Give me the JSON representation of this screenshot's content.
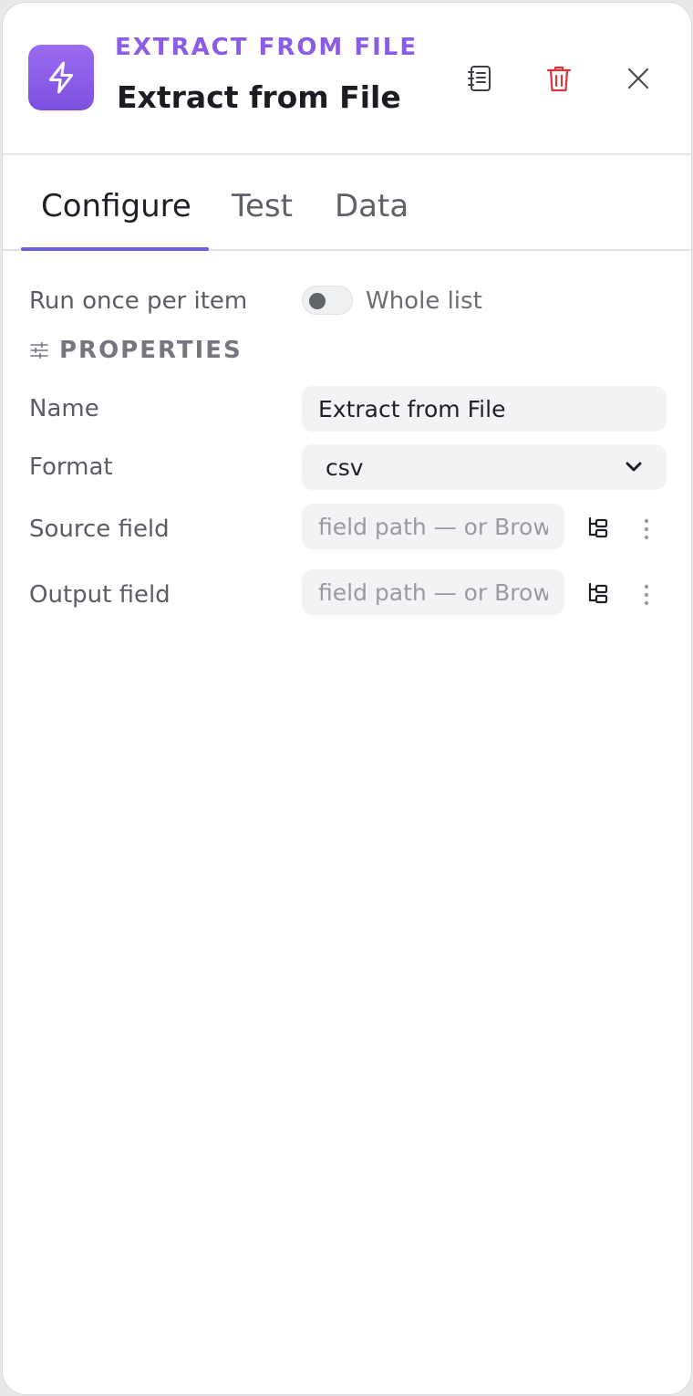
{
  "header": {
    "kicker": "EXTRACT FROM FILE",
    "title": "Extract from File",
    "icons": {
      "app": "lightning-bolt-icon",
      "docs": "notebook-icon",
      "delete": "trash-icon",
      "close": "close-icon"
    },
    "colors": {
      "accent": "#8b5ce6",
      "delete": "#d9363e"
    }
  },
  "tabs": [
    {
      "label": "Configure",
      "active": true
    },
    {
      "label": "Test",
      "active": false
    },
    {
      "label": "Data",
      "active": false
    }
  ],
  "run_mode": {
    "label": "Run once per item",
    "toggle_text": "Whole list",
    "enabled": false
  },
  "properties": {
    "section_title": "PROPERTIES",
    "name": {
      "label": "Name",
      "value": "Extract from File"
    },
    "format": {
      "label": "Format",
      "value": "csv",
      "options": [
        "csv"
      ]
    },
    "source_field": {
      "label": "Source field",
      "value": "",
      "placeholder": "field path — or Browse"
    },
    "output_field": {
      "label": "Output field",
      "value": "",
      "placeholder": "field path — or Browse"
    }
  }
}
